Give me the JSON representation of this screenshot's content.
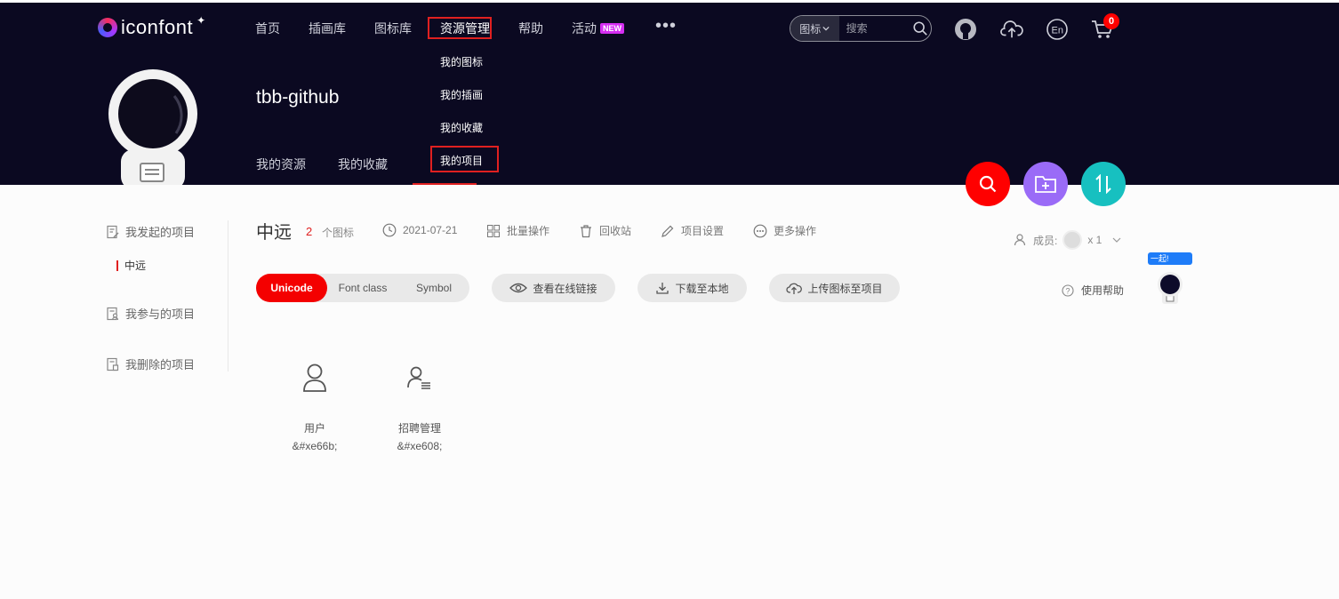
{
  "header": {
    "logo_text": "iconfont",
    "nav": [
      {
        "label": "首页"
      },
      {
        "label": "插画库"
      },
      {
        "label": "图标库"
      },
      {
        "label": "资源管理"
      },
      {
        "label": "帮助"
      },
      {
        "label": "活动"
      }
    ],
    "new_badge": "NEW",
    "more_label": "•••",
    "search": {
      "type_label": "图标",
      "placeholder": "搜索"
    },
    "cart_count": "0",
    "icons": [
      "github-icon",
      "upload-cloud-icon",
      "language-en-icon",
      "cart-icon"
    ]
  },
  "dropdown": {
    "items": [
      {
        "label": "我的图标"
      },
      {
        "label": "我的插画"
      },
      {
        "label": "我的收藏"
      },
      {
        "label": "我的项目"
      }
    ]
  },
  "profile": {
    "username": "tbb-github",
    "tabs": [
      {
        "label": "我的资源"
      },
      {
        "label": "我的收藏"
      }
    ]
  },
  "fabs": [
    {
      "name": "search-fab",
      "color": "#ff0000"
    },
    {
      "name": "new-project-fab",
      "color": "#9a6bf7"
    },
    {
      "name": "sort-fab",
      "color": "#17c0c0"
    }
  ],
  "sidebar": {
    "groups": [
      {
        "label": "我发起的项目"
      },
      {
        "label": "我参与的项目"
      },
      {
        "label": "我删除的项目"
      }
    ],
    "active_project": "中远"
  },
  "project": {
    "name": "中远",
    "icon_count": "2",
    "icon_count_unit": "个图标",
    "date": "2021-07-21",
    "actions": [
      {
        "label": "批量操作"
      },
      {
        "label": "回收站"
      },
      {
        "label": "项目设置"
      },
      {
        "label": "更多操作"
      }
    ],
    "members_label": "成员:",
    "members_count": "x 1"
  },
  "toolbar": {
    "modes": [
      {
        "label": "Unicode",
        "active": true
      },
      {
        "label": "Font class",
        "active": false
      },
      {
        "label": "Symbol",
        "active": false
      }
    ],
    "view_online_link": "查看在线链接",
    "download_local": "下载至本地",
    "upload_icons": "上传图标至项目",
    "help": "使用帮助"
  },
  "mascot_tag": "一起!",
  "icons": [
    {
      "name": "用户",
      "code": "&#xe66b;",
      "glyph": "user-icon"
    },
    {
      "name": "招聘管理",
      "code": "&#xe608;",
      "glyph": "user-list-icon"
    }
  ],
  "colors": {
    "accent": "#f40000",
    "header_bg": "#0b0921",
    "highlight_outline": "#e02020"
  }
}
